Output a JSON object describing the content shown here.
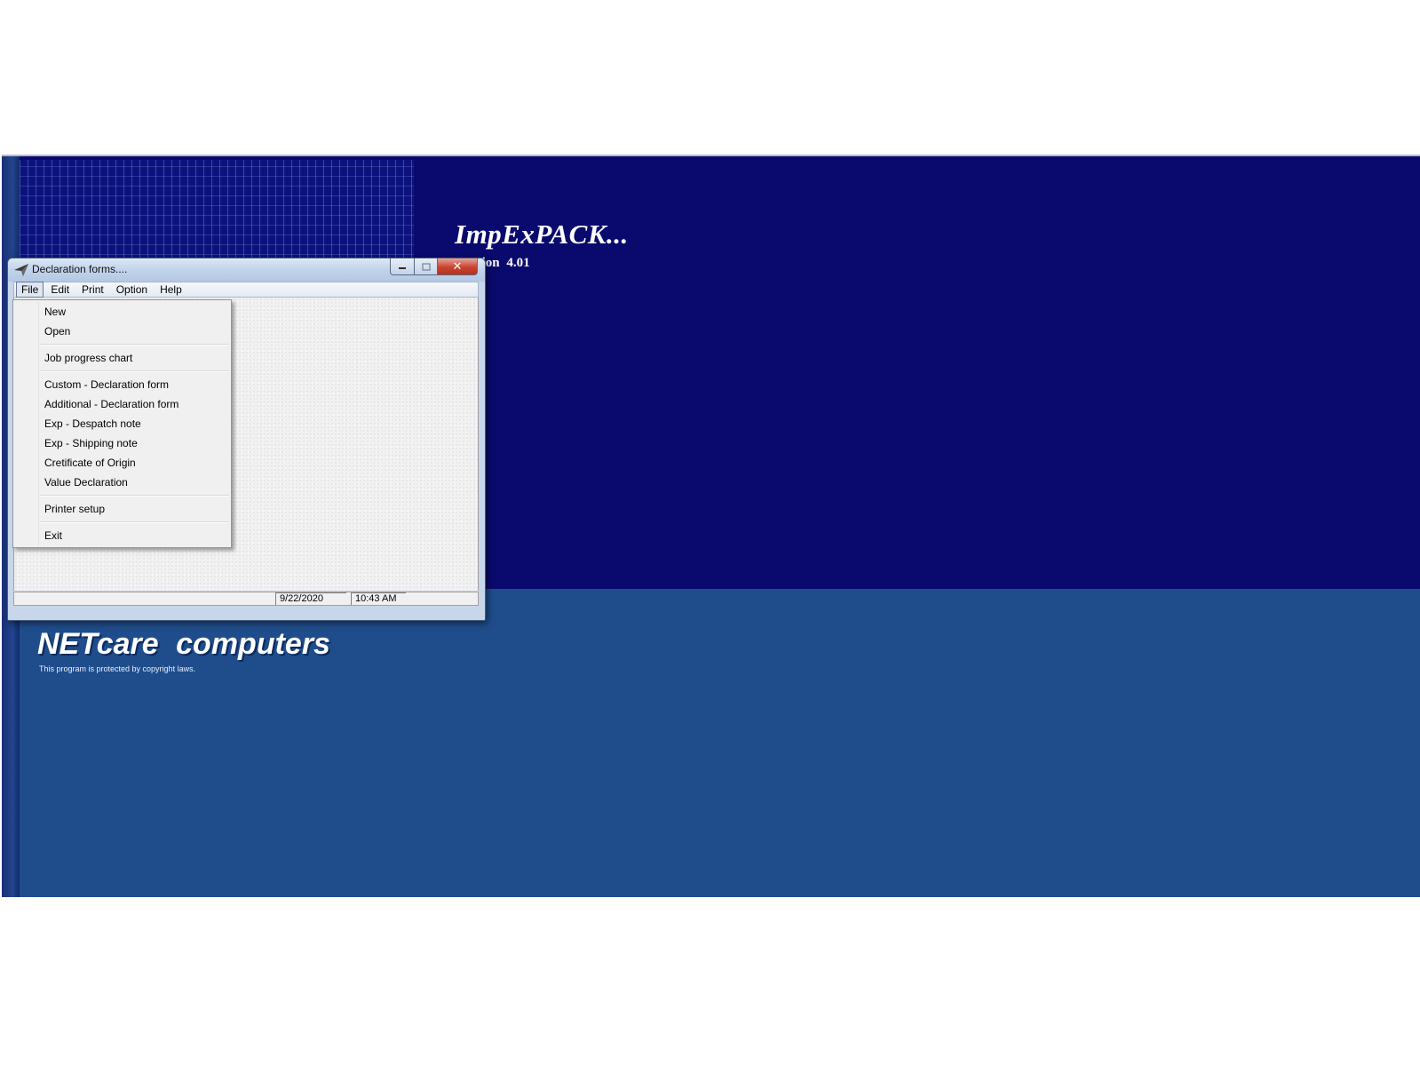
{
  "splash": {
    "product_title": "ImpExPACK...",
    "version_text": "Version 4.01",
    "company_name": "NETcare computers",
    "copyright": "This program is protected by copyright laws."
  },
  "window": {
    "title": "Declaration forms....",
    "menubar": [
      "File",
      "Edit",
      "Print",
      "Option",
      "Help"
    ],
    "active_menu": "File",
    "status": {
      "date": "9/22/2020",
      "time": "10:43 AM"
    }
  },
  "file_menu": {
    "items": [
      "New",
      "Open",
      "Job progress chart",
      "Custom - Declaration form",
      "Additional - Declaration form",
      "Exp - Despatch note",
      "Exp - Shipping note",
      "Cretificate of Origin",
      "Value Declaration",
      "Printer setup",
      "Exit"
    ]
  },
  "colors": {
    "splash_dark_blue": "#0a0a6e",
    "splash_mid_blue": "#1f4d8c",
    "close_button_red": "#c8432f"
  }
}
